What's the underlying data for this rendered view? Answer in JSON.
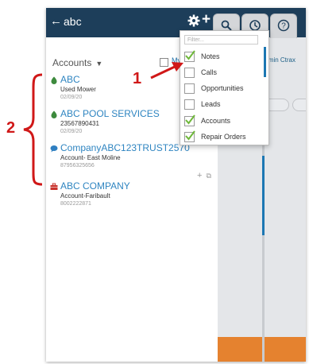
{
  "header": {
    "back_label": "abc",
    "back_icon": "arrow-left-icon",
    "settings_icon": "gear-icon",
    "add_icon": "plus-icon"
  },
  "tabs": [
    {
      "icon": "search-icon"
    },
    {
      "icon": "clock-icon"
    },
    {
      "icon": "help-icon"
    }
  ],
  "right_pane": {
    "text": "lmin Ctrax"
  },
  "list_header": {
    "title": "Accounts",
    "caret": "▼",
    "my_label": "My"
  },
  "records": [
    {
      "icon": "lead-icon",
      "name": "ABC",
      "sub": "Used Mower",
      "meta": "02/09/20"
    },
    {
      "icon": "lead-icon",
      "name": "ABC POOL SERVICES",
      "sub": "23567890431",
      "meta": "02/09/20"
    },
    {
      "icon": "chat-icon",
      "name": "CompanyABC123TRUST2570",
      "sub": "Account- East Moline",
      "meta": "87956325656"
    },
    {
      "icon": "toolbox-icon",
      "name": "ABC COMPANY",
      "sub": "Account-Faribault",
      "meta": "8002222871"
    }
  ],
  "row_actions": {
    "add": "+",
    "open": "⧉"
  },
  "filter": {
    "placeholder": "Filter..."
  },
  "filter_options": [
    {
      "label": "Notes",
      "checked": true
    },
    {
      "label": "Calls",
      "checked": false
    },
    {
      "label": "Opportunities",
      "checked": false
    },
    {
      "label": "Leads",
      "checked": false
    },
    {
      "label": "Accounts",
      "checked": true
    },
    {
      "label": "Repair Orders",
      "checked": true
    }
  ],
  "annotations": {
    "one": "1",
    "two": "2"
  },
  "colors": {
    "header": "#1d3e5a",
    "link": "#2f85c1",
    "annotation": "#d01818",
    "accent_bar": "#e5822f",
    "scroll": "#1c77b3",
    "check": "#6fb83a"
  }
}
